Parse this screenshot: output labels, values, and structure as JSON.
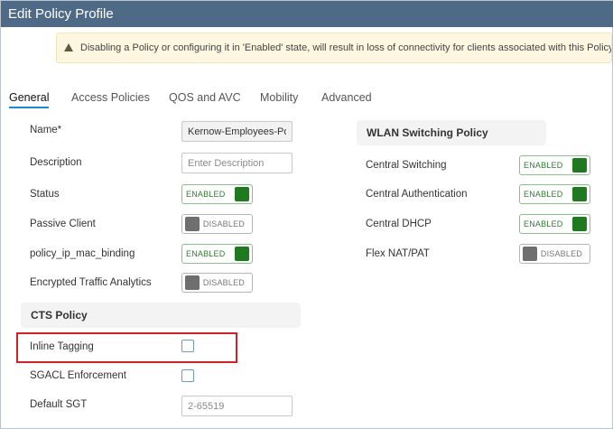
{
  "window": {
    "title": "Edit Policy Profile"
  },
  "alert": {
    "message": "Disabling a Policy or configuring it in 'Enabled' state, will result in loss of connectivity for clients associated with this Policy profile."
  },
  "tabs": [
    {
      "label": "General",
      "active": true
    },
    {
      "label": "Access Policies",
      "active": false
    },
    {
      "label": "QOS and AVC",
      "active": false
    },
    {
      "label": "Mobility",
      "active": false
    },
    {
      "label": "Advanced",
      "active": false
    }
  ],
  "general": {
    "name": {
      "label": "Name*",
      "value": "Kernow-Employees-Policy"
    },
    "description": {
      "label": "Description",
      "placeholder": "Enter Description"
    },
    "status": {
      "label": "Status",
      "state": "ENABLED"
    },
    "passive_client": {
      "label": "Passive Client",
      "state": "DISABLED"
    },
    "policy_ip_mac_binding": {
      "label": "policy_ip_mac_binding",
      "state": "ENABLED"
    },
    "encrypted_traffic_analytics": {
      "label": "Encrypted Traffic Analytics",
      "state": "DISABLED"
    }
  },
  "cts_policy": {
    "title": "CTS Policy",
    "inline_tagging": {
      "label": "Inline Tagging",
      "checked": false
    },
    "sgacl_enforcement": {
      "label": "SGACL Enforcement",
      "checked": false
    },
    "default_sgt": {
      "label": "Default SGT",
      "placeholder": "2-65519"
    }
  },
  "wlan_switching": {
    "title": "WLAN Switching Policy",
    "central_switching": {
      "label": "Central Switching",
      "state": "ENABLED"
    },
    "central_authentication": {
      "label": "Central Authentication",
      "state": "ENABLED"
    },
    "central_dhcp": {
      "label": "Central DHCP",
      "state": "ENABLED"
    },
    "flex_nat_pat": {
      "label": "Flex NAT/PAT",
      "state": "DISABLED"
    }
  },
  "colors": {
    "titlebar": "#4f6a87",
    "tab_active": "#1f88d1",
    "enabled": "#1f7a1f",
    "highlight": "#d0202a",
    "alert_bg": "#fdf6e0"
  }
}
